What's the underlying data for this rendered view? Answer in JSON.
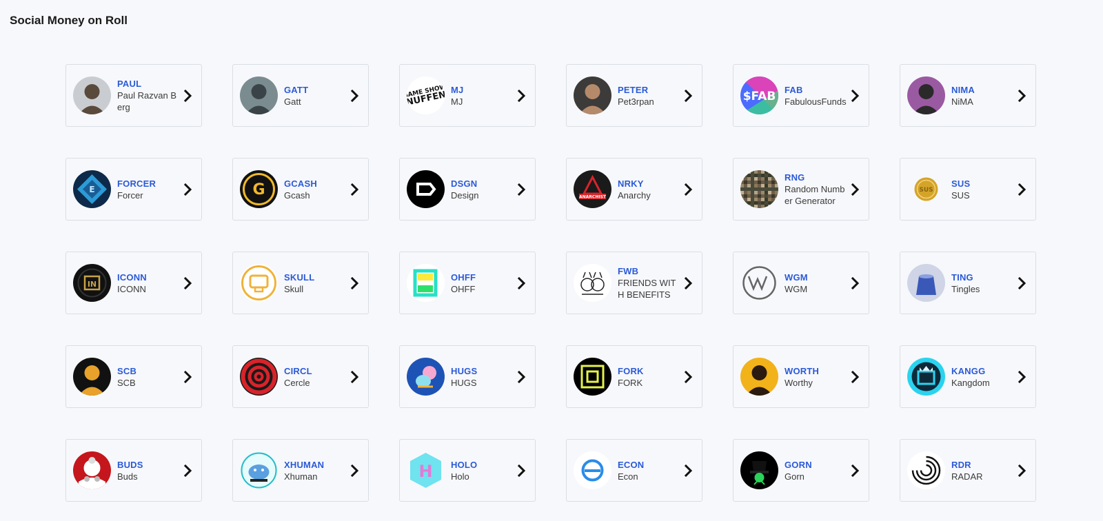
{
  "page": {
    "title": "Social Money on Roll"
  },
  "tokens": [
    {
      "ticker": "PAUL",
      "name": "Paul Razvan Berg",
      "icon": "paul-avatar-icon",
      "colors": [
        "#c9cdd1",
        "#5a4a3c"
      ]
    },
    {
      "ticker": "GATT",
      "name": "Gatt",
      "icon": "gatt-avatar-icon",
      "colors": [
        "#7a8c90",
        "#3a4448"
      ]
    },
    {
      "ticker": "MJ",
      "name": "MJ",
      "icon": "mj-logo-icon",
      "colors": [
        "#ffffff",
        "#111111"
      ]
    },
    {
      "ticker": "PETER",
      "name": "Pet3rpan",
      "icon": "peter-avatar-icon",
      "colors": [
        "#3c3b3a",
        "#b58a6b"
      ]
    },
    {
      "ticker": "FAB",
      "name": "FabulousFunds",
      "icon": "fab-logo-icon",
      "colors": [
        "#ff3aa8",
        "#4b6cff"
      ]
    },
    {
      "ticker": "NIMA",
      "name": "NiMA",
      "icon": "nima-avatar-icon",
      "colors": [
        "#9a5aa2",
        "#2a2a2a"
      ]
    },
    {
      "ticker": "FORCER",
      "name": "Forcer",
      "icon": "forcer-logo-icon",
      "colors": [
        "#0d2a4a",
        "#2c9bd6"
      ]
    },
    {
      "ticker": "GCASH",
      "name": "Gcash",
      "icon": "gcash-logo-icon",
      "colors": [
        "#111111",
        "#f1b92a"
      ]
    },
    {
      "ticker": "DSGN",
      "name": "Design",
      "icon": "dsgn-logo-icon",
      "colors": [
        "#000000",
        "#ffffff"
      ]
    },
    {
      "ticker": "NRKY",
      "name": "Anarchy",
      "icon": "nrky-logo-icon",
      "colors": [
        "#1a1a1a",
        "#d8232a"
      ]
    },
    {
      "ticker": "RNG",
      "name": "Random Number Generator",
      "icon": "rng-mosaic-icon",
      "colors": [
        "#8a7a5a",
        "#4a4a3a"
      ]
    },
    {
      "ticker": "SUS",
      "name": "SUS",
      "icon": "sus-coin-icon",
      "colors": [
        "#f7f8fb",
        "#d4a429"
      ]
    },
    {
      "ticker": "ICONN",
      "name": "ICONN",
      "icon": "iconn-logo-icon",
      "colors": [
        "#111111",
        "#c8a24a"
      ]
    },
    {
      "ticker": "SKULL",
      "name": "Skull",
      "icon": "skull-logo-icon",
      "colors": [
        "#ffffff",
        "#f0b23a"
      ]
    },
    {
      "ticker": "OHFF",
      "name": "OHFF",
      "icon": "ohff-logo-icon",
      "colors": [
        "#ffffff",
        "#28e0c6"
      ]
    },
    {
      "ticker": "FWB",
      "name": "FRIENDS WITH BENEFITS",
      "icon": "fwb-logo-icon",
      "colors": [
        "#ffffff",
        "#222222"
      ]
    },
    {
      "ticker": "WGM",
      "name": "WGM",
      "icon": "wgm-logo-icon",
      "colors": [
        "#f7f8fb",
        "#666666"
      ]
    },
    {
      "ticker": "TING",
      "name": "Tingles",
      "icon": "ting-logo-icon",
      "colors": [
        "#cfd4e6",
        "#3a58b8"
      ]
    },
    {
      "ticker": "SCB",
      "name": "SCB",
      "icon": "scb-avatar-icon",
      "colors": [
        "#111111",
        "#e8a12a"
      ]
    },
    {
      "ticker": "CIRCL",
      "name": "Cercle",
      "icon": "circl-logo-icon",
      "colors": [
        "#d8232a",
        "#1a1a1a"
      ]
    },
    {
      "ticker": "HUGS",
      "name": "HUGS",
      "icon": "hugs-logo-icon",
      "colors": [
        "#1e53b6",
        "#f7a8d0"
      ]
    },
    {
      "ticker": "FORK",
      "name": "FORK",
      "icon": "fork-logo-icon",
      "colors": [
        "#000000",
        "#e3f24a"
      ]
    },
    {
      "ticker": "WORTH",
      "name": "Worthy",
      "icon": "worth-avatar-icon",
      "colors": [
        "#f2b21a",
        "#2a1a10"
      ]
    },
    {
      "ticker": "KANGG",
      "name": "Kangdom",
      "icon": "kangg-logo-icon",
      "colors": [
        "#2ad3ef",
        "#0e2a3a"
      ]
    },
    {
      "ticker": "BUDS",
      "name": "Buds",
      "icon": "buds-logo-icon",
      "colors": [
        "#c4161c",
        "#ffffff"
      ]
    },
    {
      "ticker": "XHUMAN",
      "name": "Xhuman",
      "icon": "xhuman-logo-icon",
      "colors": [
        "#e6fbfb",
        "#2ab8c8"
      ]
    },
    {
      "ticker": "HOLO",
      "name": "Holo",
      "icon": "holo-logo-icon",
      "colors": [
        "#6fe3ef",
        "#e27bd6"
      ]
    },
    {
      "ticker": "ECON",
      "name": "Econ",
      "icon": "econ-logo-icon",
      "colors": [
        "#ffffff",
        "#2a8ce8"
      ]
    },
    {
      "ticker": "GORN",
      "name": "Gorn",
      "icon": "gorn-logo-icon",
      "colors": [
        "#000000",
        "#2ad35a"
      ]
    },
    {
      "ticker": "RDR",
      "name": "RADAR",
      "icon": "rdr-logo-icon",
      "colors": [
        "#ffffff",
        "#111111"
      ]
    }
  ]
}
